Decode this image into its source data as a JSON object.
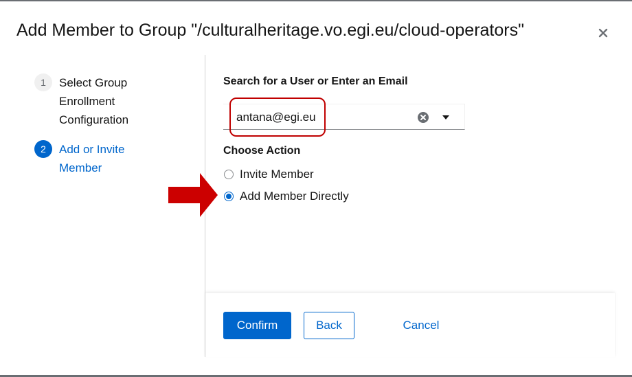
{
  "modal": {
    "title": "Add Member to Group \"/culturalheritage.vo.egi.eu/cloud-operators\"",
    "close_icon": "close-icon"
  },
  "wizard": {
    "steps": [
      {
        "number": "1",
        "label": "Select Group Enrollment Configuration",
        "state": "completed"
      },
      {
        "number": "2",
        "label": "Add or Invite Member",
        "state": "current"
      }
    ]
  },
  "search": {
    "label": "Search for a User or Enter an Email",
    "value": "antana@egi.eu",
    "clear_icon": "clear-circle-icon",
    "toggle_icon": "caret-down-icon"
  },
  "action": {
    "label": "Choose Action",
    "options": [
      {
        "label": "Invite Member",
        "checked": false
      },
      {
        "label": "Add Member Directly",
        "checked": true
      }
    ]
  },
  "footer": {
    "confirm_label": "Confirm",
    "back_label": "Back",
    "cancel_label": "Cancel"
  },
  "annotations": {
    "highlight_color": "#c00000",
    "arrow_color": "#cc0000"
  },
  "colors": {
    "accent": "#0066cc",
    "text": "#151515",
    "border": "#d2d2d2"
  }
}
